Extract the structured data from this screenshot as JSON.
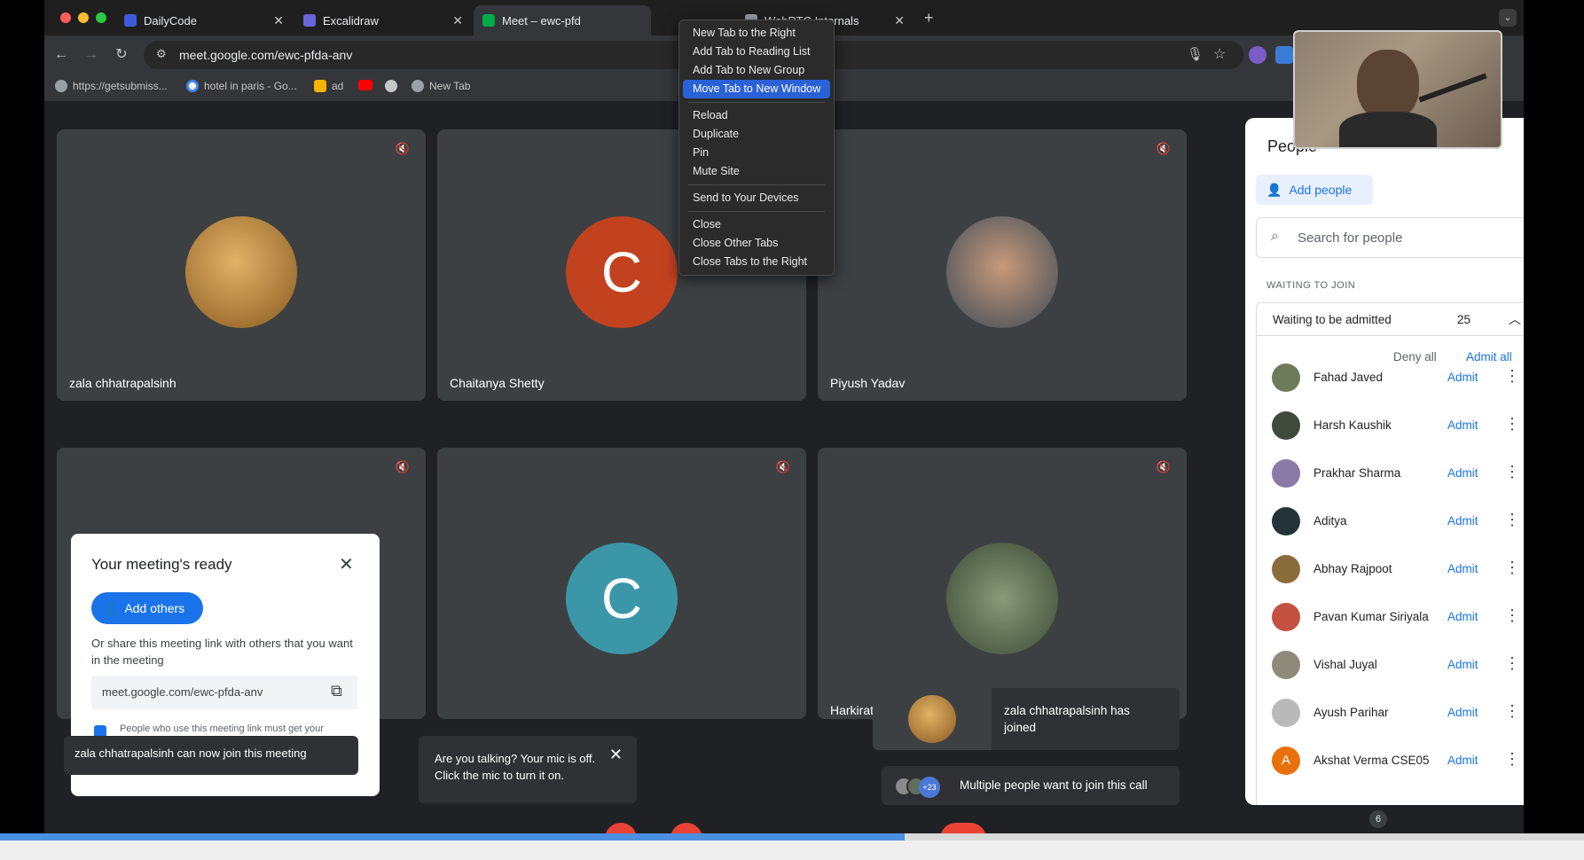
{
  "browser": {
    "tabs": [
      {
        "title": "DailyCode",
        "favicon_color": "#3b5bdb"
      },
      {
        "title": "Excalidraw",
        "favicon_color": "#6965db"
      },
      {
        "title": "Meet – ewc-pfd",
        "favicon_color": "#00ac47"
      },
      {
        "title": "WebRTC Internals",
        "favicon_color": "#9aa0a6"
      }
    ],
    "url": "meet.google.com/ewc-pfda-anv",
    "bookmarks": [
      {
        "label": "https://getsubmiss..."
      },
      {
        "label": "hotel in paris - Go..."
      },
      {
        "label": "ad"
      },
      {
        "label": ""
      },
      {
        "label": ""
      },
      {
        "label": "New Tab"
      }
    ]
  },
  "context_menu": {
    "items": [
      "New Tab to the Right",
      "Add Tab to Reading List",
      "Add Tab to New Group",
      "Move Tab to New Window",
      "Reload",
      "Duplicate",
      "Pin",
      "Mute Site",
      "Send to Your Devices",
      "Close",
      "Close Other Tabs",
      "Close Tabs to the Right"
    ],
    "highlighted": "Move Tab to New Window"
  },
  "tiles": [
    {
      "name": "zala chhatrapalsinh",
      "initial": "",
      "avatar_color": "#b8862e"
    },
    {
      "name": "Chaitanya Shetty",
      "initial": "C",
      "avatar_color": "#c2421f"
    },
    {
      "name": "Piyush Yadav",
      "initial": "",
      "avatar_color": "#8d8d8d"
    },
    {
      "name": "",
      "initial": "",
      "avatar_color": ""
    },
    {
      "name": "",
      "initial": "C",
      "avatar_color": "#3b97a8"
    },
    {
      "name": "Harkirat Singh",
      "initial": "",
      "avatar_color": "#6b7c5a"
    }
  ],
  "meeting_ready": {
    "title": "Your meeting's ready",
    "add_others": "Add others",
    "share_text": "Or share this meeting link with others that you want in the meeting",
    "link": "meet.google.com/ewc-pfda-anv",
    "notice": "People who use this meeting link must get your",
    "toast": "zala chhatrapalsinh can now join this meeting"
  },
  "mic_tooltip": {
    "text": "Are you talking? Your mic is off. Click the mic to turn it on."
  },
  "join_toast": {
    "text": "zala chhatrapalsinh has joined"
  },
  "multi_toast": {
    "badge": "+23",
    "text": "Multiple people want to join this call"
  },
  "people_panel": {
    "title": "People",
    "add_people": "Add people",
    "search_placeholder": "Search for people",
    "section_label": "WAITING TO JOIN",
    "waiting_label": "Waiting to be admitted",
    "waiting_count": "25",
    "deny_all": "Deny all",
    "admit_all": "Admit all",
    "admit_label": "Admit",
    "people": [
      {
        "name": "Fahad Javed",
        "color": "#6d7b5a"
      },
      {
        "name": "Harsh Kaushik",
        "color": "#3f4a3c"
      },
      {
        "name": "Prakhar Sharma",
        "color": "#8a7aa8"
      },
      {
        "name": "Aditya",
        "color": "#24333a"
      },
      {
        "name": "Abhay Rajpoot",
        "color": "#8a6b3a"
      },
      {
        "name": "Pavan Kumar Siriyala",
        "color": "#c4503f"
      },
      {
        "name": "Vishal Juyal",
        "color": "#8e8a7a"
      },
      {
        "name": "Ayush Parihar",
        "color": "#b9b9b9"
      },
      {
        "name": "Akshat Verma CSE05",
        "color": "#e8710a",
        "initial": "A"
      }
    ],
    "participant_count": "6"
  }
}
